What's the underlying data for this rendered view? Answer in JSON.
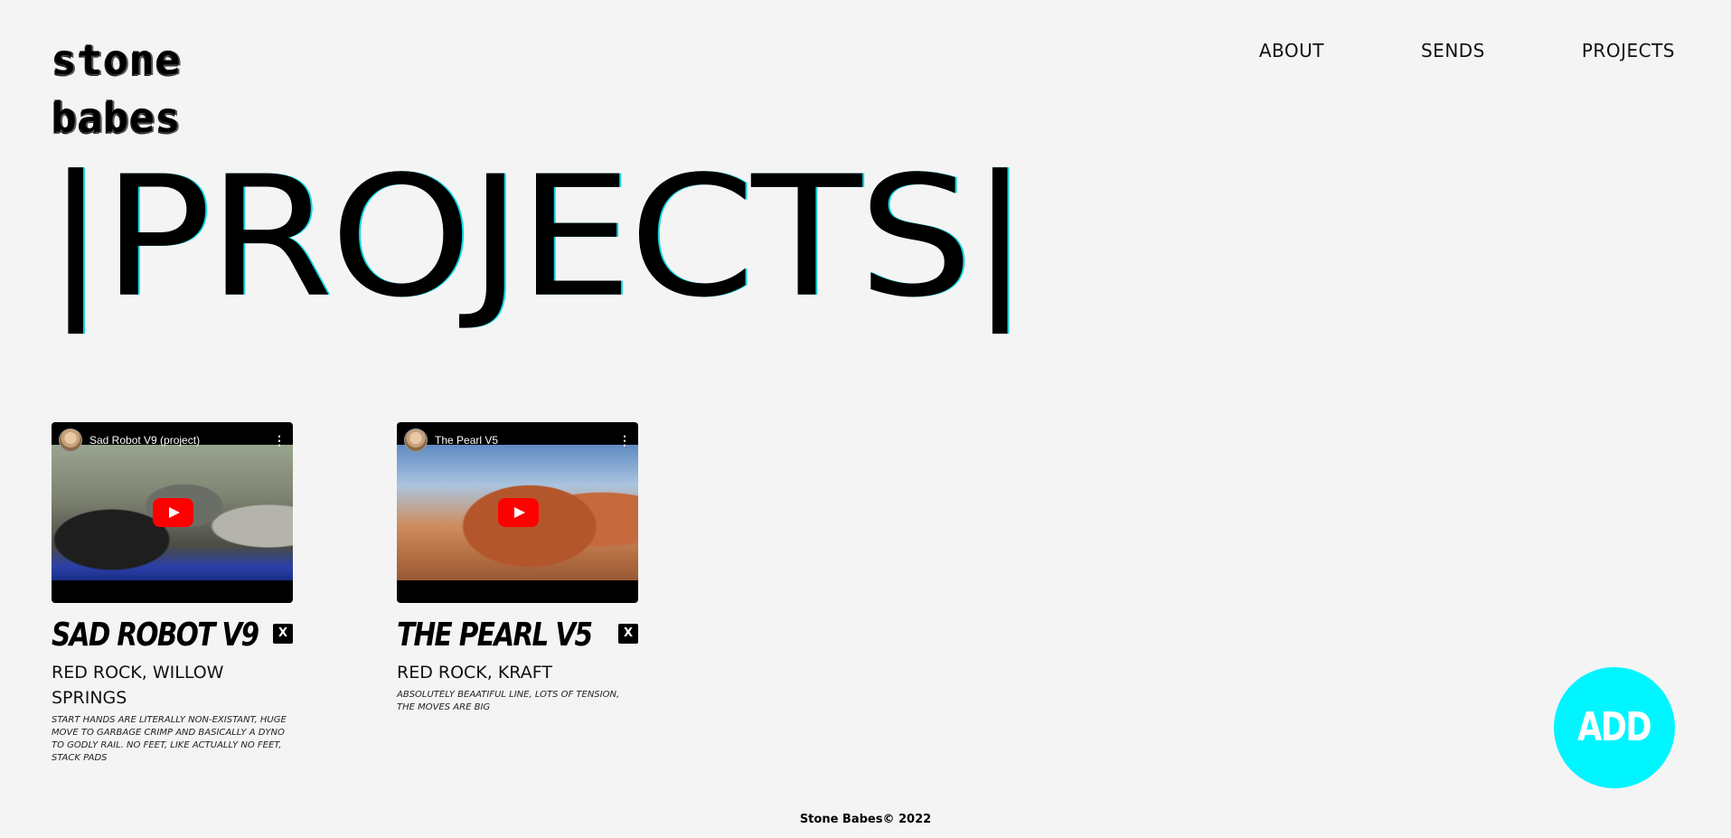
{
  "logo": {
    "line1": "stone",
    "line2": "babes"
  },
  "nav": [
    {
      "label": "ABOUT"
    },
    {
      "label": "SENDS"
    },
    {
      "label": "PROJECTS"
    }
  ],
  "hero": {
    "title": "|PROJECTS|"
  },
  "projects": [
    {
      "video_title": "Sad Robot V9 (project)",
      "title": "SAD ROBOT V9",
      "delete_label": "X",
      "location": "RED ROCK, WILLOW SPRINGS",
      "description": "START HANDS ARE LITERALLY NON-EXISTANT, HUGE MOVE TO GARBAGE CRIMP AND BASICALLY A DYNO TO GODLY RAIL. NO FEET, LIKE ACTUALLY NO FEET, STACK PADS"
    },
    {
      "video_title": "The Pearl V5",
      "title": "THE PEARL V5",
      "delete_label": "X",
      "location": "RED ROCK, KRAFT",
      "description": "ABSOLUTELY BEAATIFUL LINE, LOTS OF TENSION, THE MOVES ARE BIG"
    }
  ],
  "icons": {
    "play": "play-icon",
    "more": "more-vertical-icon",
    "avatar": "channel-avatar"
  },
  "add_button": {
    "label": "ADD",
    "color": "#00f5ff"
  },
  "footer": {
    "text": "Stone Babes© 2022"
  }
}
